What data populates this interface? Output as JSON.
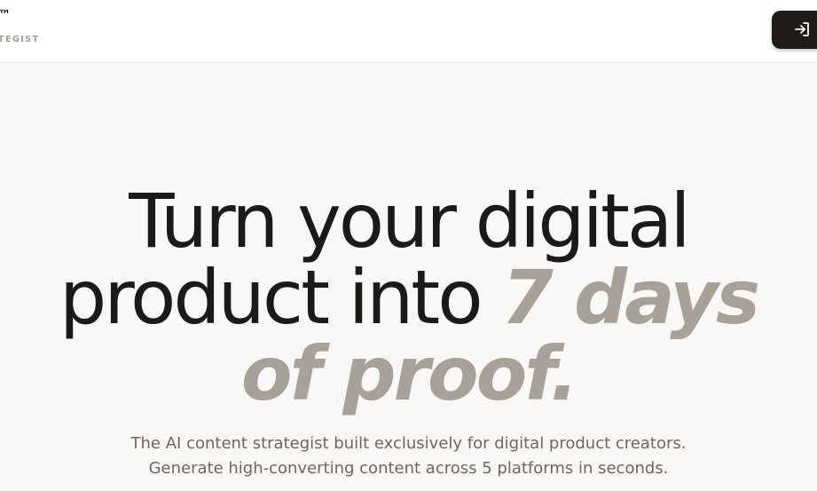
{
  "header": {
    "logo_mark": "™",
    "logo_subtitle": "TEGIST",
    "login_icon": "sign-in-icon"
  },
  "hero": {
    "title_line1": "Turn your digital",
    "title_line2_plain": "product into ",
    "title_line2_accent": "7 days",
    "title_line3_accent": "of proof.",
    "subtitle_line1": "The AI content strategist built exclusively for digital product creators.",
    "subtitle_line2": "Generate high-converting content across 5 platforms in seconds."
  },
  "colors": {
    "background": "#f9f8f6",
    "header_background": "#ffffff",
    "title_text": "#1c1a18",
    "accent_text": "#a7a19a",
    "subtitle_text": "#6d6760",
    "button_background": "#1e1b18"
  }
}
